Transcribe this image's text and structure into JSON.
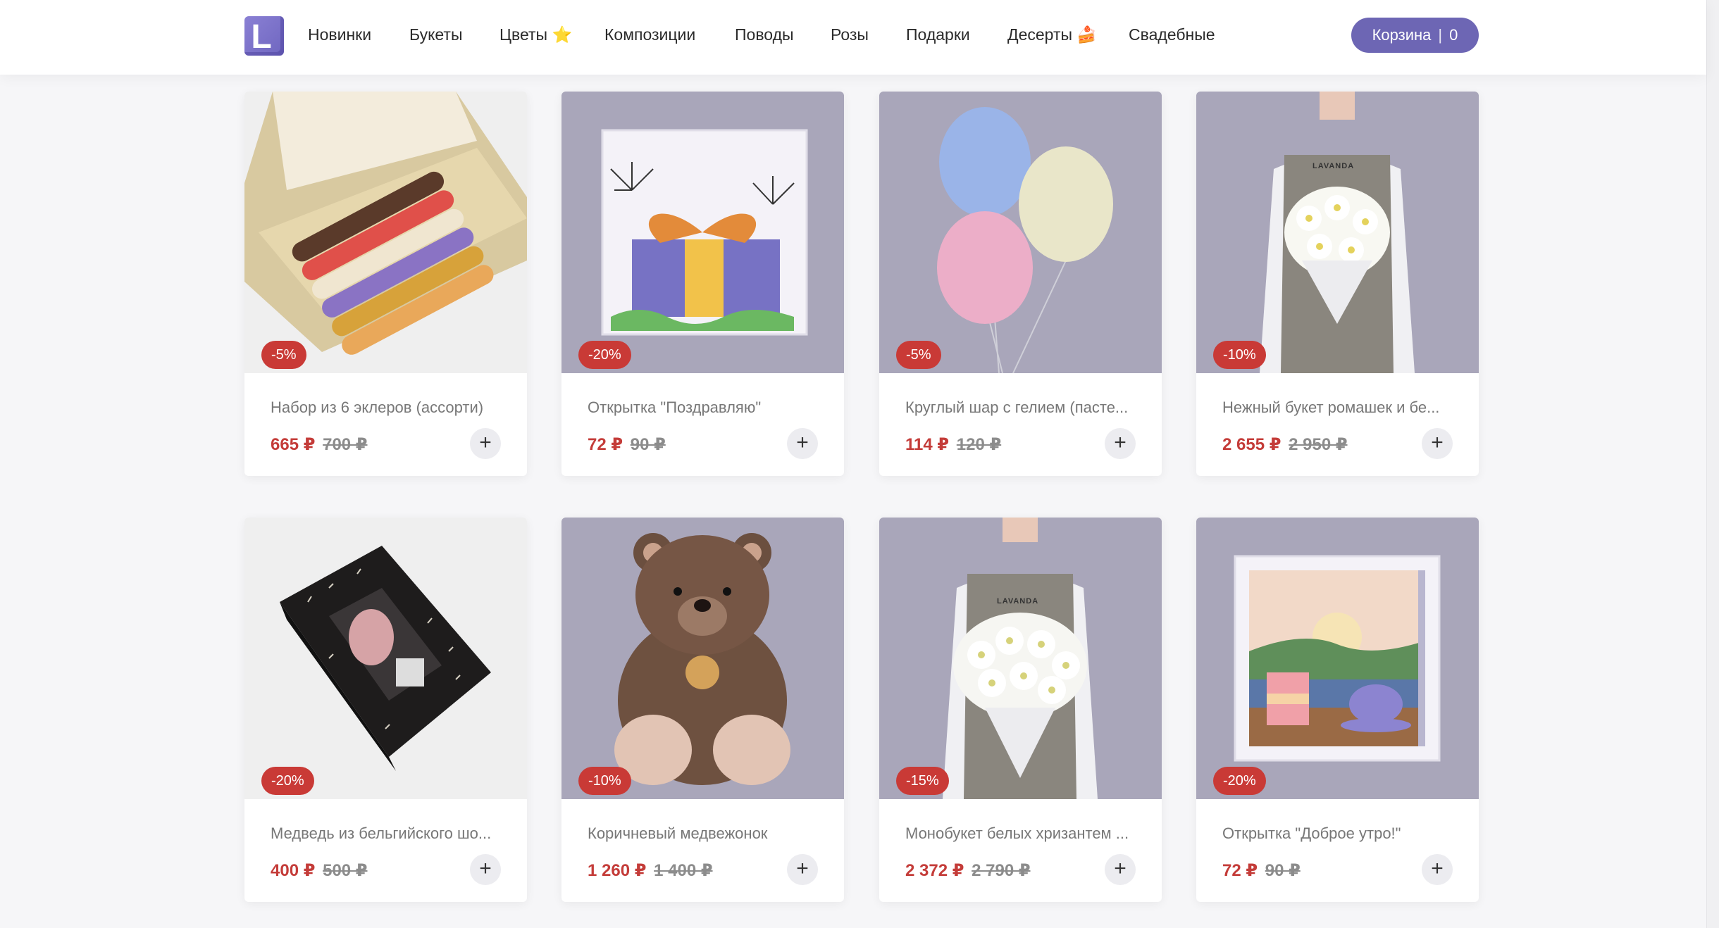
{
  "header": {
    "logo_letter": "L",
    "nav": [
      {
        "label": "Новинки"
      },
      {
        "label": "Букеты"
      },
      {
        "label": "Цветы ⭐"
      },
      {
        "label": "Композиции"
      },
      {
        "label": "Поводы"
      },
      {
        "label": "Розы"
      },
      {
        "label": "Подарки"
      },
      {
        "label": "Десерты 🍰"
      },
      {
        "label": "Свадебные"
      }
    ],
    "cart": {
      "label": "Корзина",
      "separator": "|",
      "count": "0"
    }
  },
  "products": [
    {
      "title": "Набор из 6 эклеров (ассорти)",
      "discount": "-5%",
      "price": "665 ₽",
      "old_price": "700 ₽",
      "image": "eclairs"
    },
    {
      "title": "Открытка \"Поздравляю\"",
      "discount": "-20%",
      "price": "72 ₽",
      "old_price": "90 ₽",
      "image": "gift-card"
    },
    {
      "title": "Круглый шар с гелием (пасте...",
      "discount": "-5%",
      "price": "114 ₽",
      "old_price": "120 ₽",
      "image": "balloons"
    },
    {
      "title": "Нежный букет ромашек и бе...",
      "discount": "-10%",
      "price": "2 655 ₽",
      "old_price": "2 950 ₽",
      "image": "bouquet-daisies",
      "apron_text": "LAVANDA"
    },
    {
      "title": "Медведь из бельгийского шо...",
      "discount": "-20%",
      "price": "400 ₽",
      "old_price": "500 ₽",
      "image": "chocolate-bear-box"
    },
    {
      "title": "Коричневый медвежонок",
      "discount": "-10%",
      "price": "1 260 ₽",
      "old_price": "1 400 ₽",
      "image": "teddy-bear"
    },
    {
      "title": "Монобукет белых хризантем ...",
      "discount": "-15%",
      "price": "2 372 ₽",
      "old_price": "2 790 ₽",
      "image": "bouquet-chrysanthemums",
      "apron_text": "LAVANDA"
    },
    {
      "title": "Открытка \"Доброе утро!\"",
      "discount": "-20%",
      "price": "72 ₽",
      "old_price": "90 ₽",
      "image": "morning-card"
    }
  ],
  "colors": {
    "accent": "#6d66b4",
    "discount": "#c93a36",
    "price": "#c43c39"
  }
}
